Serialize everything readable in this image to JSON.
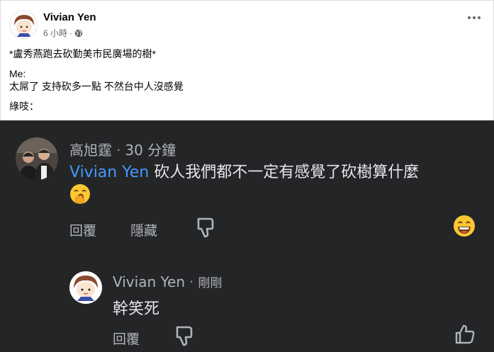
{
  "post": {
    "author": "Vivian Yen",
    "time": "6 小時",
    "dot": "·",
    "privacy_icon": "public-globe-icon",
    "lines": [
      "*盧秀燕跑去砍勤美市民廣場的樹*",
      "Me:",
      "太屌了 支持砍多一點 不然台中人沒感覺",
      "綠吱："
    ]
  },
  "comment1": {
    "author": "高旭霆",
    "dot": "·",
    "time": "30 分鐘",
    "mention": "Vivian Yen",
    "text": " 砍人我們都不一定有感覺了砍樹算什麼",
    "emoji": "yawning-face-emoji",
    "reply_label": "回覆",
    "hide_label": "隱藏",
    "reaction": "laughing-face-emoji"
  },
  "comment2": {
    "author": "Vivian Yen",
    "dot": "·",
    "time": "剛剛",
    "text": "幹笑死",
    "reply_label": "回覆"
  },
  "colors": {
    "dark_bg": "#242526",
    "mention": "#4599ff",
    "text_light": "#e4e6eb",
    "text_muted": "#b0b3b8"
  }
}
